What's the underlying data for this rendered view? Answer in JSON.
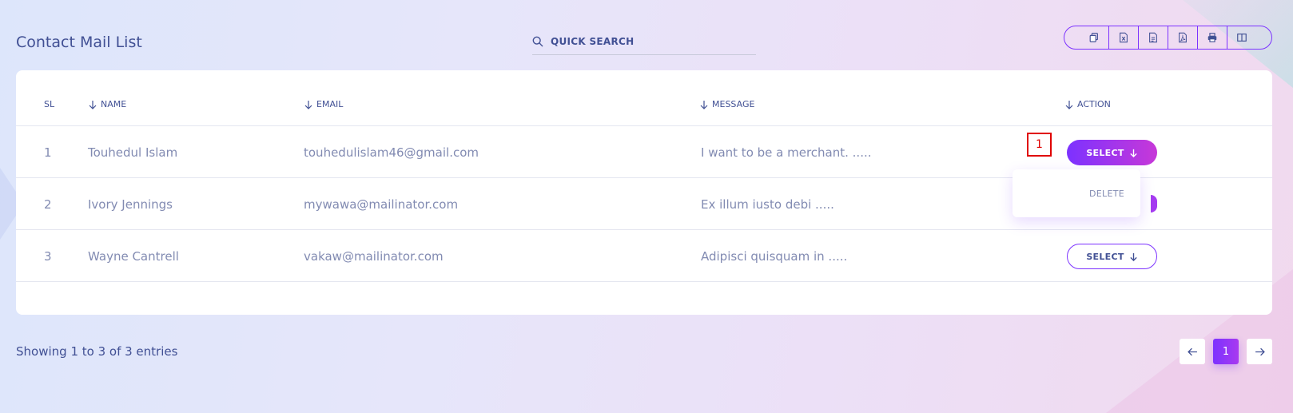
{
  "page": {
    "title": "Contact Mail List"
  },
  "search": {
    "placeholder": "QUICK SEARCH"
  },
  "toolbar": {
    "buttons": [
      {
        "icon": "copy-icon"
      },
      {
        "icon": "excel-icon"
      },
      {
        "icon": "csv-icon"
      },
      {
        "icon": "pdf-icon"
      },
      {
        "icon": "print-icon"
      },
      {
        "icon": "columns-icon"
      }
    ]
  },
  "table": {
    "headers": {
      "sl": "SL",
      "name": "NAME",
      "email": "EMAIL",
      "message": "MESSAGE",
      "action": "ACTION"
    },
    "rows": [
      {
        "sl": "1",
        "name": "Touhedul Islam",
        "email": "touhedulislam46@gmail.com",
        "message": "I want to be a merchant. .....",
        "action": "SELECT"
      },
      {
        "sl": "2",
        "name": "Ivory Jennings",
        "email": "mywawa@mailinator.com",
        "message": "Ex illum iusto debi .....",
        "action": "SELECT"
      },
      {
        "sl": "3",
        "name": "Wayne Cantrell",
        "email": "vakaw@mailinator.com",
        "message": "Adipisci quisquam in .....",
        "action": "SELECT"
      }
    ]
  },
  "dropdown": {
    "items": [
      "DELETE"
    ]
  },
  "annotation": {
    "marker": "1"
  },
  "footer": {
    "info": "Showing 1 to 3 of 3 entries"
  },
  "pagination": {
    "current": "1"
  },
  "colors": {
    "accent": "#7c32ff",
    "accent_end": "#c738d8",
    "text": "#415094",
    "muted": "#828bb2"
  }
}
